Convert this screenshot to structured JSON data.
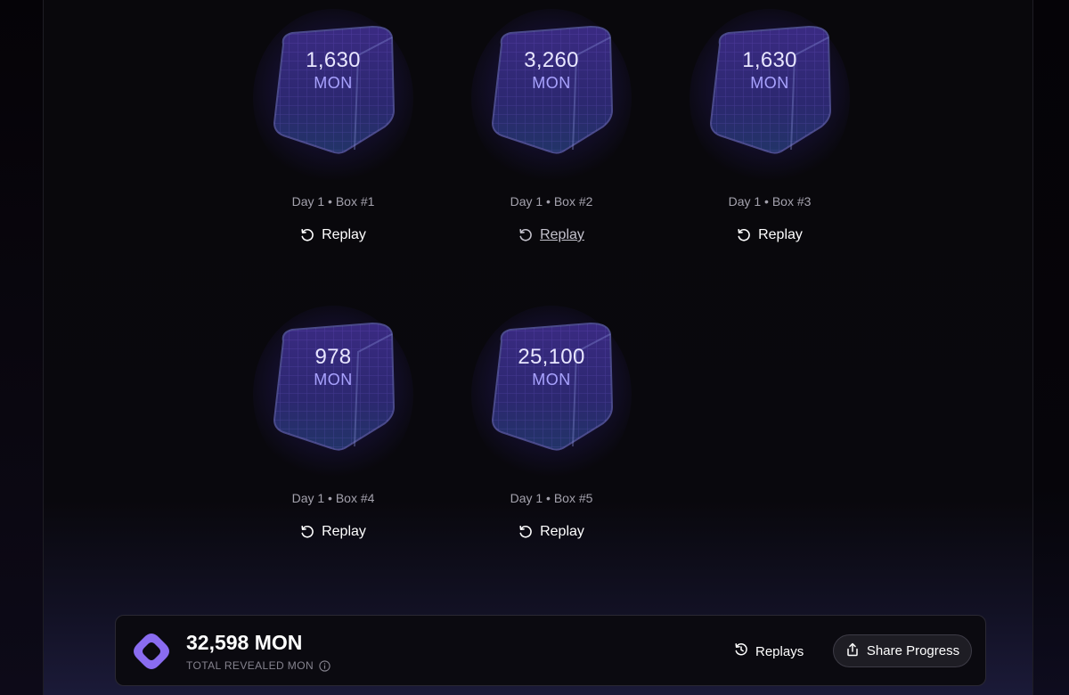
{
  "boxes": [
    {
      "amount": "1,630",
      "unit": "MON",
      "label": "Day 1 • Box #1",
      "replay_label": "Replay"
    },
    {
      "amount": "3,260",
      "unit": "MON",
      "label": "Day 1 • Box #2",
      "replay_label": "Replay"
    },
    {
      "amount": "1,630",
      "unit": "MON",
      "label": "Day 1 • Box #3",
      "replay_label": "Replay"
    },
    {
      "amount": "978",
      "unit": "MON",
      "label": "Day 1 • Box #4",
      "replay_label": "Replay"
    },
    {
      "amount": "25,100",
      "unit": "MON",
      "label": "Day 1 • Box #5",
      "replay_label": "Replay"
    }
  ],
  "footer": {
    "total_amount": "32,598 MON",
    "total_label": "TOTAL REVEALED MON",
    "replays_label": "Replays",
    "share_label": "Share Progress"
  },
  "icons": {
    "replay": "replay-icon",
    "history": "history-icon",
    "share": "share-icon",
    "info": "info-icon",
    "logo": "monad-logo"
  },
  "colors": {
    "background": "#09080c",
    "accent": "#8a6cf0",
    "cube_glow": "#5a3cdc",
    "amount_text": "#e8e6ff",
    "unit_text": "#a9a3ff",
    "muted_text": "#a4a2ad"
  }
}
